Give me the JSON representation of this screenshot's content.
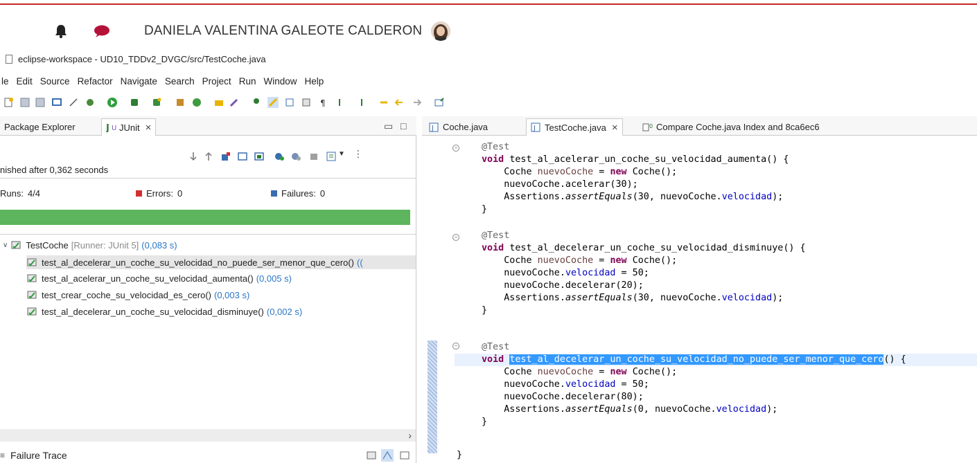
{
  "user": {
    "name": "DANIELA VALENTINA GALEOTE CALDERON"
  },
  "window": {
    "title": "eclipse-workspace - UD10_TDDv2_DVGC/src/TestCoche.java"
  },
  "menu": [
    "le",
    "Edit",
    "Source",
    "Refactor",
    "Navigate",
    "Search",
    "Project",
    "Run",
    "Window",
    "Help"
  ],
  "left_tabs": {
    "package_explorer": "Package Explorer",
    "junit": "JUnit"
  },
  "junit": {
    "finished": "nished after 0,362 seconds",
    "runs_label": "Runs:",
    "runs_value": "4/4",
    "errors_label": "Errors:",
    "errors_value": "0",
    "failures_label": "Failures:",
    "failures_value": "0",
    "progress": 1.0,
    "root": {
      "name": "TestCoche",
      "runner": "[Runner: JUnit 5]",
      "time": "(0,083 s)"
    },
    "tests": [
      {
        "name": "test_al_decelerar_un_coche_su_velocidad_no_puede_ser_menor_que_cero()",
        "time": "(("
      },
      {
        "name": "test_al_acelerar_un_coche_su_velocidad_aumenta()",
        "time": "(0,005 s)"
      },
      {
        "name": "test_crear_coche_su_velocidad_es_cero()",
        "time": "(0,003 s)"
      },
      {
        "name": "test_al_decelerar_un_coche_su_velocidad_disminuye()",
        "time": "(0,002 s)"
      }
    ],
    "failure_trace": "Failure Trace"
  },
  "editor_tabs": [
    {
      "label": "Coche.java"
    },
    {
      "label": "TestCoche.java"
    },
    {
      "label": "Compare Coche.java Index and 8ca6ec6"
    }
  ],
  "code": {
    "ann": "@Test",
    "void": "void",
    "new": "new",
    "t1": "test_al_acelerar_un_coche_su_velocidad_aumenta",
    "t2": "test_al_decelerar_un_coche_su_velocidad_disminuye",
    "t3": "test_al_decelerar_un_coche_su_velocidad_no_puede_ser_menor_que_cero",
    "var": "nuevoCoche",
    "field": "velocidad",
    "type": "Coche",
    "assert_call": "assertEquals",
    "assertions": "Assertions.",
    "acelerar": "nuevoCoche.acelerar(30);",
    "decelerar20": "nuevoCoche.decelerar(20);",
    "decelerar80": "nuevoCoche.decelerar(80);",
    "assign50": " = 50;",
    "exp30": "(30, ",
    "exp0": "(0, ",
    "sig_tail": "() {",
    "close_brace": "}"
  },
  "colors": {
    "accent_red": "#c62828",
    "progress_green": "#5db55d",
    "selection_blue": "#3399ff"
  }
}
